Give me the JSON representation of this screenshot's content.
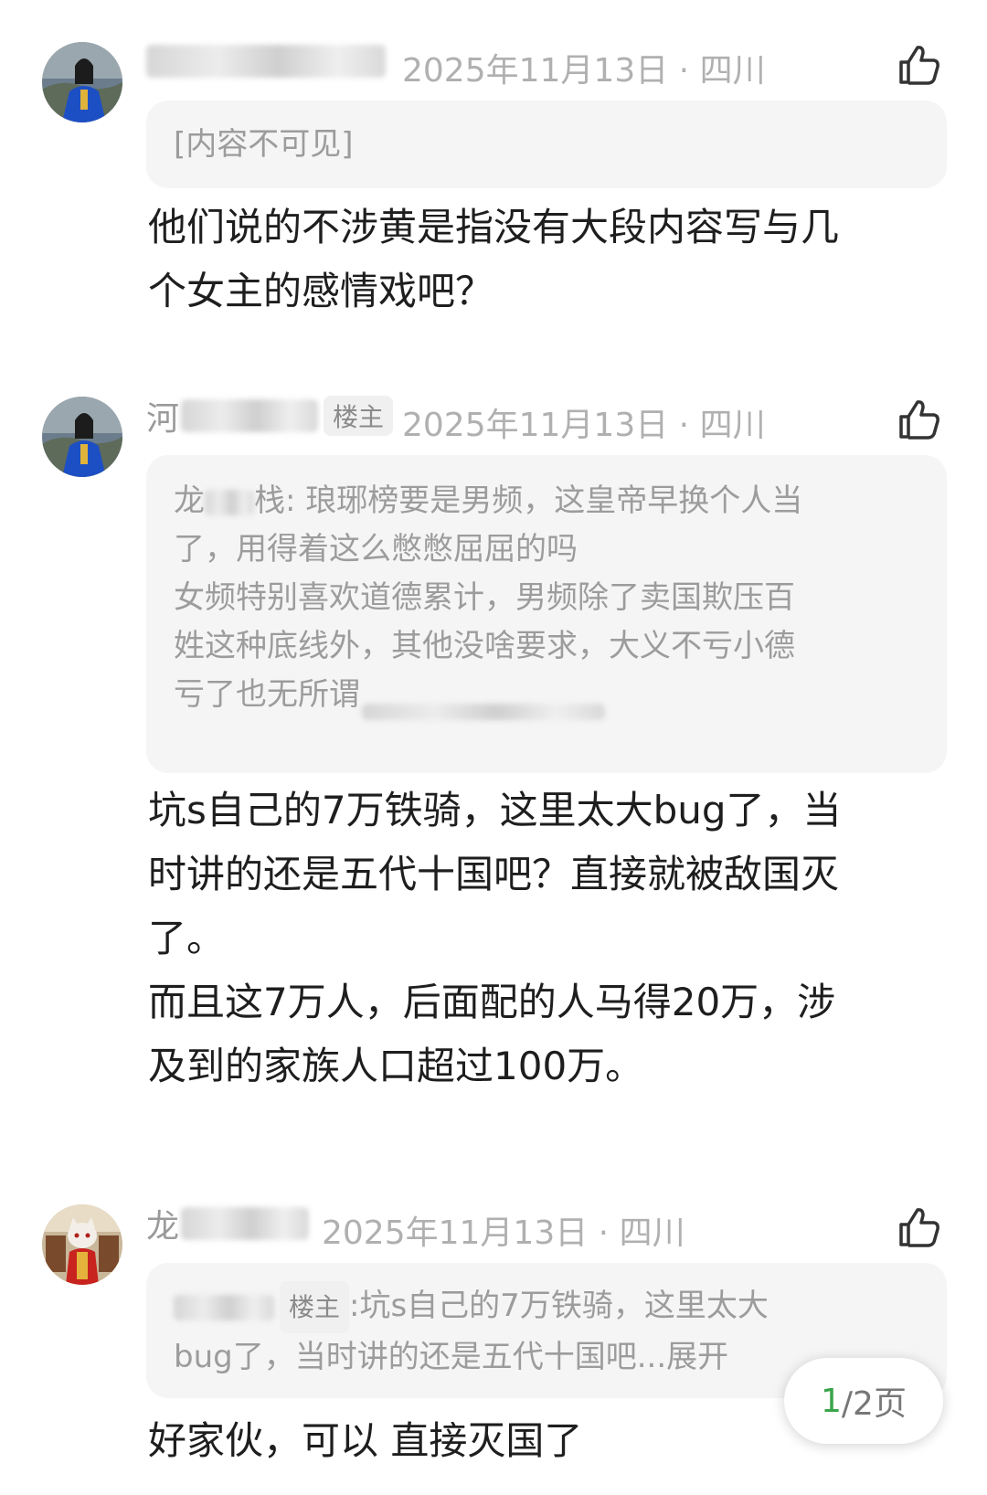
{
  "comments": [
    {
      "name_visible": "",
      "tag": "",
      "meta": "2025年11月13日 · 四川",
      "quote": [
        "[内容不可见]"
      ],
      "body": [
        "他们说的不涉黄是指没有大段内容写与几",
        "个女主的感情戏吧？"
      ]
    },
    {
      "name_visible": "河",
      "tag": "楼主",
      "meta": "2025年11月13日 · 四川",
      "quote_name": "龙",
      "quote_name_tail": "栈: 琅琊榜要是男频，这皇帝早换个人当",
      "quote": [
        "了，用得着这么憋憋屈屈的吗",
        "女频特别喜欢道德累计，男频除了卖国欺压百",
        "姓这种底线外，其他没啥要求，大义不亏小德",
        "亏了也无所谓"
      ],
      "body": [
        "坑s自己的7万铁骑，这里太大bug了，当",
        "时讲的还是五代十国吧？直接就被敌国灭",
        "了。",
        "而且这7万人，后面配的人马得20万，涉",
        "及到的家族人口超过100万。"
      ]
    },
    {
      "name_visible": "龙",
      "tag": "",
      "meta": "2025年11月13日 · 四川",
      "quote_tag": "楼主",
      "quote_first_tail": ":坑s自己的7万铁骑，这里太大",
      "quote": [
        "bug了，当时讲的还是五代十国吧...展开"
      ],
      "body": [
        "好家伙，可以 直接灭国了"
      ]
    }
  ],
  "pager": {
    "current": "1",
    "rest": "/2页"
  },
  "icons": {
    "like": "thumbs-up-icon"
  }
}
